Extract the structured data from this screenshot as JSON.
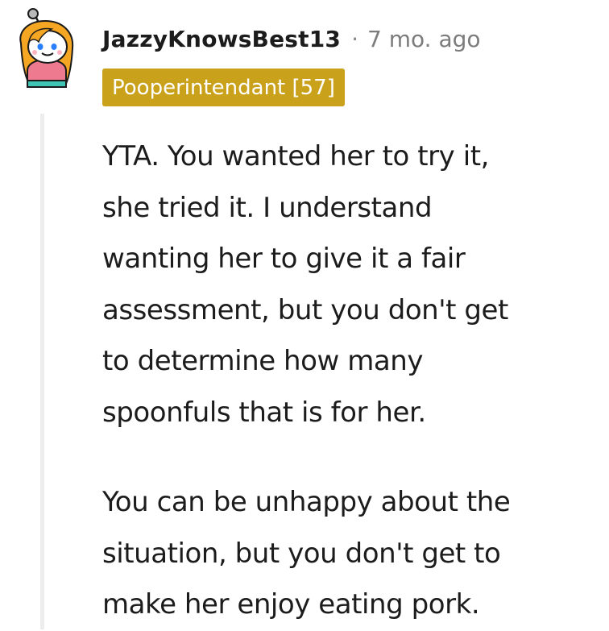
{
  "comment": {
    "username": "JazzyKnowsBest13",
    "separator": "·",
    "timestamp": "7 mo. ago",
    "flair": "Pooperintendant [57]",
    "avatar_icon": "reddit-snoo-avatar-icon",
    "paragraphs": [
      {
        "lines": [
          "YTA. You wanted her to try it,",
          "she tried it. I understand",
          "wanting her to give it a fair",
          "assessment, but you don't get",
          "to determine how many",
          "spoonfuls that is for her."
        ]
      },
      {
        "lines": [
          "You can be unhappy about the",
          "situation, but you don't get to",
          "make her enjoy eating pork."
        ]
      }
    ]
  },
  "colors": {
    "flair_background": "#c9a11a",
    "flair_text": "#ffffff",
    "username": "#1c1c1c",
    "meta": "#7c7c7c",
    "body_text": "#1c1c1c",
    "thread_line": "#ededed",
    "avatar_hair": "#f5a623",
    "avatar_skin": "#ffffff"
  }
}
